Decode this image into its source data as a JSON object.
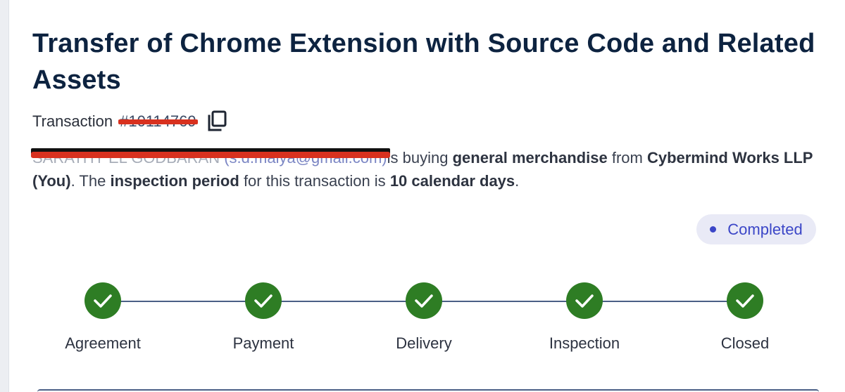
{
  "title": "Transfer of Chrome Extension with Source Code and Related Assets",
  "transaction": {
    "label": "Transaction",
    "id_redacted": "#10114769",
    "copy_icon": "copy-icon"
  },
  "summary": {
    "buyer_name_redacted": "SARATHY EL GODBARAN",
    "buyer_email_redacted": "(s.d.maiya@gmail.com)",
    "text_is_buying": "is buying",
    "goods": "general merchandise",
    "text_from": "from",
    "seller": "Cybermind Works LLP",
    "seller_role": "(You)",
    "text_inspection_pre": ". The",
    "inspection_label": "inspection period",
    "text_inspection_mid": "for this transaction is",
    "inspection_value": "10 calendar days",
    "text_end": "."
  },
  "status": {
    "label": "Completed",
    "color": "#3b46c7"
  },
  "steps": [
    {
      "label": "Agreement",
      "done": true
    },
    {
      "label": "Payment",
      "done": true
    },
    {
      "label": "Delivery",
      "done": true
    },
    {
      "label": "Inspection",
      "done": true
    },
    {
      "label": "Closed",
      "done": true
    }
  ],
  "colors": {
    "title": "#0d2340",
    "step_complete": "#2e7d24",
    "connector": "#4a5f86",
    "badge_bg": "#e9eaf6",
    "redaction_red": "#d8311f"
  }
}
